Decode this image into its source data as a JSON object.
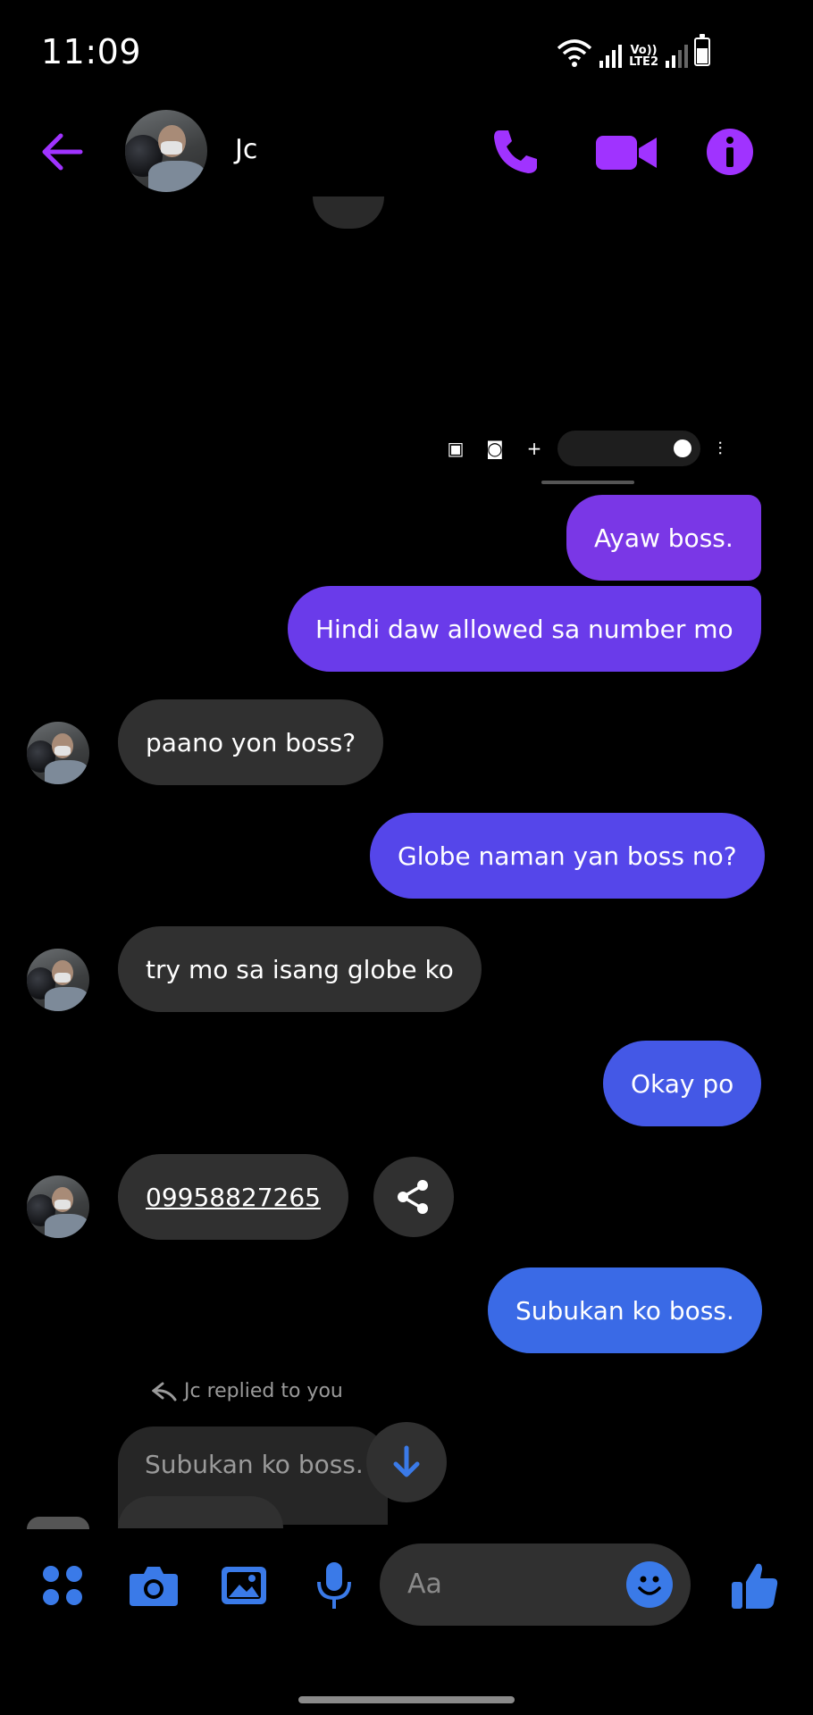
{
  "status_bar": {
    "time": "11:09",
    "network_label_top": "Vo))",
    "network_label_bottom": "LTE2"
  },
  "header": {
    "contact_name": "Jc",
    "back_icon": "arrow-left-icon",
    "call_icon": "phone-icon",
    "video_icon": "video-camera-icon",
    "info_icon": "info-icon"
  },
  "colors": {
    "accent_purple": "#a033ff",
    "accent_blue": "#3a7ae8",
    "bubble_incoming": "#303030"
  },
  "messages": [
    {
      "direction": "outgoing",
      "text": "Ayaw boss.",
      "color": "#7a37e6"
    },
    {
      "direction": "outgoing",
      "text": "Hindi daw allowed sa number mo",
      "color": "#6a3bea"
    },
    {
      "direction": "incoming",
      "text": "paano yon boss?"
    },
    {
      "direction": "outgoing",
      "text": "Globe naman yan boss no?",
      "color": "#5546ea"
    },
    {
      "direction": "incoming",
      "text": "try mo sa isang globe ko"
    },
    {
      "direction": "outgoing",
      "text": "Okay po",
      "color": "#4458e6"
    },
    {
      "direction": "incoming",
      "text": "09958827265",
      "is_link": true
    },
    {
      "direction": "outgoing",
      "text": "Subukan ko boss.",
      "color": "#3a6ae6"
    }
  ],
  "reply": {
    "label": "Jc replied to you",
    "quoted_text": "Subukan ko boss."
  },
  "composer": {
    "placeholder": "Aa",
    "icons": [
      "apps-grid-icon",
      "camera-icon",
      "gallery-icon",
      "microphone-icon",
      "emoji-icon",
      "thumbs-up-icon"
    ]
  }
}
